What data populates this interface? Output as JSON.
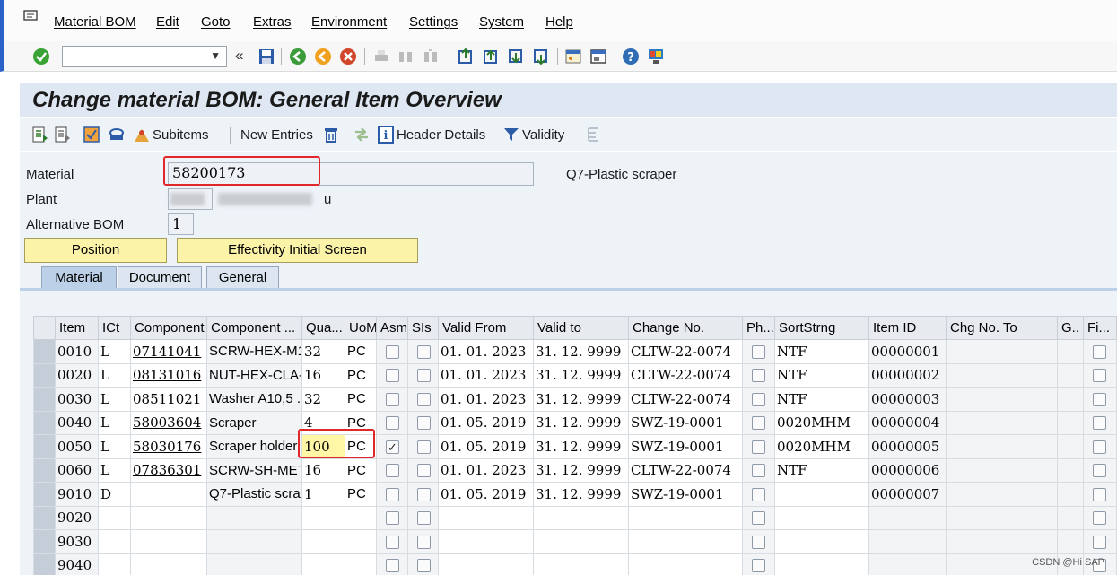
{
  "menu": {
    "items": [
      "Material BOM",
      "Edit",
      "Goto",
      "Extras",
      "Environment",
      "Settings",
      "System",
      "Help"
    ]
  },
  "toolbar": {
    "okcode_value": "",
    "back_glyph": "«",
    "icons": [
      "save-icon",
      "back-icon",
      "exit-icon",
      "cancel-icon",
      "print-icon",
      "find-icon",
      "find-next-icon",
      "first-page-icon",
      "previous-page-icon",
      "next-page-icon",
      "last-page-icon",
      "create-session-icon",
      "shortcut-icon",
      "help-icon",
      "customize-layout-icon"
    ]
  },
  "title": "Change material BOM: General Item Overview",
  "app_toolbar": {
    "subitems": "Subitems",
    "new_entries": "New Entries",
    "header_details": "Header Details",
    "validity": "Validity"
  },
  "header": {
    "material_label": "Material",
    "material_value": "58200173",
    "material_desc": "Q7-Plastic scraper",
    "plant_label": "Plant",
    "plant_desc_suffix": "u",
    "alt_bom_label": "Alternative BOM",
    "alt_bom_value": "1",
    "position_btn": "Position",
    "effectivity_btn": "Effectivity Initial Screen"
  },
  "tabs": [
    "Material",
    "Document",
    "General"
  ],
  "table": {
    "columns": [
      "Item",
      "ICt",
      "Component",
      "Component ...",
      "Qua...",
      "UoM",
      "Asm",
      "SIs",
      "Valid From",
      "Valid to",
      "Change No.",
      "Ph...",
      "SortStrng",
      "Item ID",
      "Chg No. To",
      "G..",
      "Fi..."
    ],
    "rows": [
      {
        "item": "0010",
        "ict": "L",
        "component": "07141041",
        "desc": "SCRW-HEX-M1...",
        "qty": "32",
        "uom": "PC",
        "asm": false,
        "valid_from": "01. 01. 2023",
        "valid_to": "31. 12. 9999",
        "change_no": "CLTW-22-0074",
        "sort": "NTF",
        "item_id": "00000001"
      },
      {
        "item": "0020",
        "ict": "L",
        "component": "08131016",
        "desc": "NUT-HEX-CLA-...",
        "qty": "16",
        "uom": "PC",
        "asm": false,
        "valid_from": "01. 01. 2023",
        "valid_to": "31. 12. 9999",
        "change_no": "CLTW-22-0074",
        "sort": "NTF",
        "item_id": "00000002"
      },
      {
        "item": "0030",
        "ict": "L",
        "component": "08511021",
        "desc": "Washer A10,5 ...",
        "qty": "32",
        "uom": "PC",
        "asm": false,
        "valid_from": "01. 01. 2023",
        "valid_to": "31. 12. 9999",
        "change_no": "CLTW-22-0074",
        "sort": "NTF",
        "item_id": "00000003"
      },
      {
        "item": "0040",
        "ict": "L",
        "component": "58003604",
        "desc": "Scraper",
        "qty": "4",
        "uom": "PC",
        "asm": false,
        "valid_from": "01. 05. 2019",
        "valid_to": "31. 12. 9999",
        "change_no": "SWZ-19-0001",
        "sort": "0020MHM",
        "item_id": "00000004"
      },
      {
        "item": "0050",
        "ict": "L",
        "component": "58030176",
        "desc": "Scraper holder",
        "qty": "100",
        "uom": "PC",
        "asm": true,
        "valid_from": "01. 05. 2019",
        "valid_to": "31. 12. 9999",
        "change_no": "SWZ-19-0001",
        "sort": "0020MHM",
        "item_id": "00000005"
      },
      {
        "item": "0060",
        "ict": "L",
        "component": "07836301",
        "desc": "SCRW-SH-MET...",
        "qty": "16",
        "uom": "PC",
        "asm": false,
        "valid_from": "01. 01. 2023",
        "valid_to": "31. 12. 9999",
        "change_no": "CLTW-22-0074",
        "sort": "NTF",
        "item_id": "00000006"
      },
      {
        "item": "9010",
        "ict": "D",
        "component": "",
        "desc": "Q7-Plastic scra...",
        "qty": "1",
        "uom": "PC",
        "asm": false,
        "valid_from": "01. 05. 2019",
        "valid_to": "31. 12. 9999",
        "change_no": "SWZ-19-0001",
        "sort": "",
        "item_id": "00000007"
      },
      {
        "item": "9020",
        "ict": "",
        "component": "",
        "desc": "",
        "qty": "",
        "uom": "",
        "asm": false,
        "valid_from": "",
        "valid_to": "",
        "change_no": "",
        "sort": "",
        "item_id": ""
      },
      {
        "item": "9030",
        "ict": "",
        "component": "",
        "desc": "",
        "qty": "",
        "uom": "",
        "asm": false,
        "valid_from": "",
        "valid_to": "",
        "change_no": "",
        "sort": "",
        "item_id": ""
      },
      {
        "item": "9040",
        "ict": "",
        "component": "",
        "desc": "",
        "qty": "",
        "uom": "",
        "asm": false,
        "valid_from": "",
        "valid_to": "",
        "change_no": "",
        "sort": "",
        "item_id": ""
      }
    ]
  },
  "watermark": "CSDN @Hi SAP",
  "colors": {
    "highlight_red": "#e0282b",
    "title_bg": "#dfe8f2",
    "button_yellow": "#fbf3a8"
  }
}
